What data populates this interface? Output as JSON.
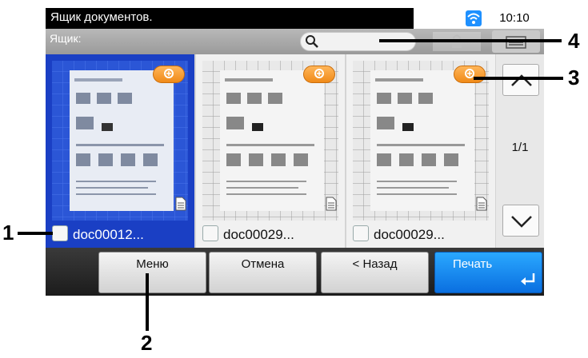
{
  "status_bar": {
    "title": "Ящик документов.",
    "time": "10:10",
    "wifi_color": "#1e90ff"
  },
  "box_bar": {
    "label": "Ящик:",
    "search_placeholder": ""
  },
  "documents": [
    {
      "name": "doc00012...",
      "selected": true
    },
    {
      "name": "doc00029...",
      "selected": false
    },
    {
      "name": "doc00029...",
      "selected": false
    }
  ],
  "pager": {
    "indicator": "1/1"
  },
  "bottom_bar": {
    "menu": "Меню",
    "cancel": "Отмена",
    "back": "< Назад",
    "print": "Печать"
  },
  "callouts": {
    "c1": "1",
    "c2": "2",
    "c3": "3",
    "c4": "4"
  },
  "colors": {
    "selected_tile": "#1a3fc4",
    "primary_button": "#1a8cf0",
    "zoom_button": "#f39a2a"
  }
}
